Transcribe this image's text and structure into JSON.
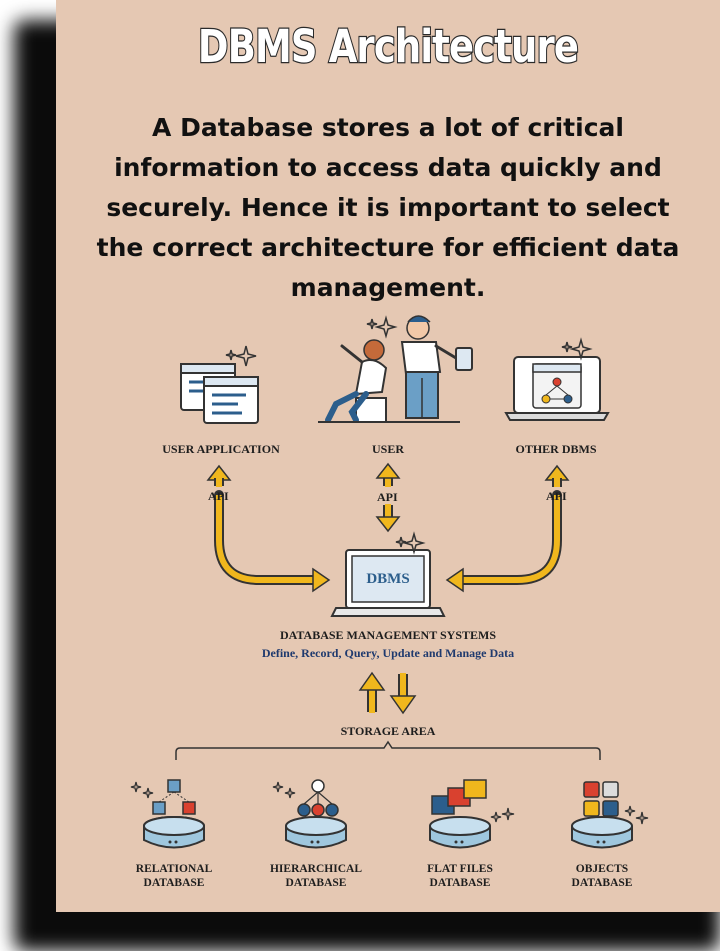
{
  "title": "DBMS Architecture",
  "intro": "A Database stores a lot of critical information to access data quickly and securely. Hence it is important to select the correct architecture for efficient data management.",
  "top_nodes": {
    "user_application": "USER APPLICATION",
    "user": "USER",
    "other_dbms": "OTHER DBMS"
  },
  "api_label": "API",
  "dbms_box_label": "DBMS",
  "dbms_title": "DATABASE MANAGEMENT SYSTEMS",
  "dbms_subtitle": "Define, Record, Query, Update and Manage Data",
  "storage_label": "STORAGE AREA",
  "databases": {
    "relational": [
      "RELATIONAL",
      "DATABASE"
    ],
    "hierarchical": [
      "HIERARCHICAL",
      "DATABASE"
    ],
    "flat": [
      "FLAT FILES",
      "DATABASE"
    ],
    "objects": [
      "OBJECTS",
      "DATABASE"
    ]
  },
  "colors": {
    "background": "#e5c8b3",
    "arrow": "#f0b71d",
    "dbms_text": "#2c5e8c",
    "subtitle": "#1f3a6e",
    "disk": "#9fc7de"
  }
}
